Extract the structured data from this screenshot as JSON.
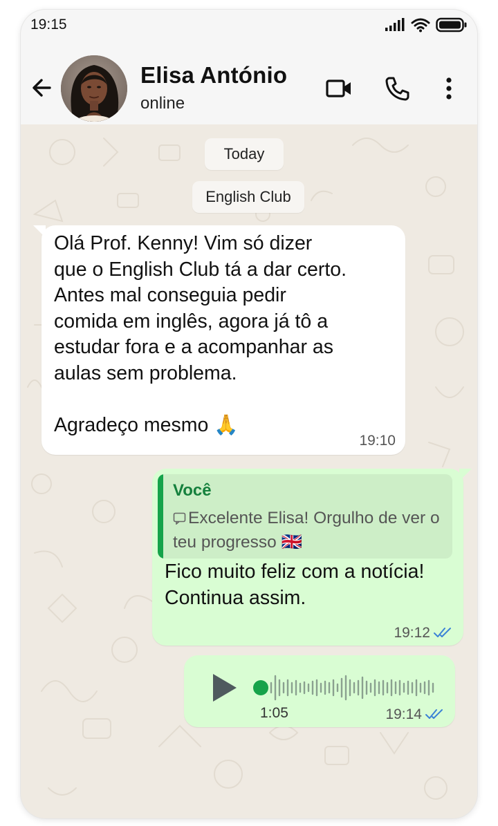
{
  "status_bar": {
    "time": "19:15",
    "icons": [
      "signal-icon",
      "wifi-icon",
      "battery-icon"
    ]
  },
  "header": {
    "contact_name": "Elisa António",
    "contact_status": "online",
    "actions": [
      "video-call-icon",
      "phone-call-icon",
      "more-options-icon"
    ]
  },
  "chat": {
    "date_label": "Today",
    "group_label": "English Club",
    "messages": [
      {
        "direction": "incoming",
        "text": "Olá Prof. Kenny! Vim só dizer\nque o English Club tá a dar certo.\nAntes mal conseguia pedir\ncomida em inglês, agora já tô a\nestudar fora e a acompanhar as\naulas sem problema.\n\nAgradeço mesmo 🙏",
        "time": "19:10"
      },
      {
        "direction": "outgoing",
        "quoted_author": "Você",
        "quoted_text": "Excelente Elisa! Orgulho de ver o teu progresso 🇬🇧",
        "text": "Fico muito feliz com a notícia! Continua assim.",
        "time": "19:12",
        "status": "read"
      },
      {
        "direction": "outgoing",
        "type": "voice",
        "duration": "1:05",
        "time": "19:14",
        "status": "read"
      }
    ]
  },
  "colors": {
    "outgoing_bubble": "#d9fdd3",
    "incoming_bubble": "#ffffff",
    "wallpaper": "#efeae2",
    "accent_green": "#15a34a",
    "read_ticks": "#3b82d6"
  }
}
